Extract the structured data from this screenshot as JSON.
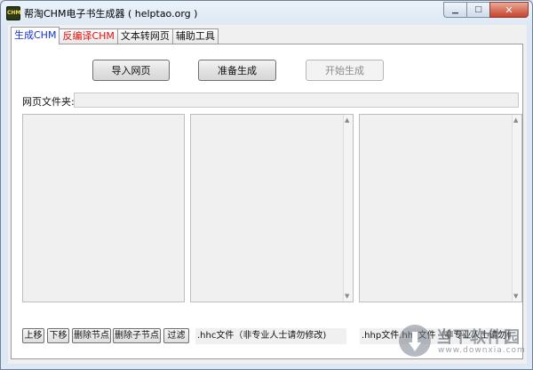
{
  "window": {
    "title": "帮淘CHM电子书生成器 ( helptao.org )",
    "icon_text": "CHM"
  },
  "tabs": [
    {
      "label": "生成CHM"
    },
    {
      "label": "反编译CHM"
    },
    {
      "label": "文本转网页"
    },
    {
      "label": "辅助工具"
    }
  ],
  "buttons": {
    "import": "导入网页",
    "prepare": "准备生成",
    "start": "开始生成"
  },
  "folder_label": "网页文件夹:",
  "folder_value": "",
  "tree_buttons": [
    "上移",
    "下移",
    "删除节点",
    "删除子节点",
    "过滤"
  ],
  "captions": {
    "hhc": ".hhc文件（非专业人士请勿修改)",
    "hhp": ".hhp文件.hhc文件（非专业人士请勿修改"
  },
  "watermark": {
    "text": "当下软件园",
    "sub": "www.downxia.com"
  }
}
